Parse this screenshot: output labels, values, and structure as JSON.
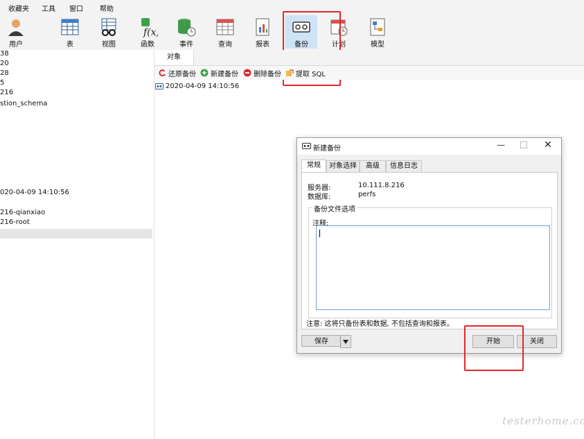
{
  "menu": {
    "items": [
      "收藏夹",
      "工具",
      "窗口",
      "帮助"
    ]
  },
  "toolbar": {
    "user": "用户",
    "table": "表",
    "view": "视图",
    "function": "函数",
    "event": "事件",
    "query": "查询",
    "report": "报表",
    "backup": "备份",
    "schedule": "计划",
    "model": "模型"
  },
  "tree": {
    "rows": [
      "38",
      "20",
      "28",
      "5",
      "216",
      "stion_schema",
      "020-04-09 14:10:56",
      "216-qianxiao",
      "216-root"
    ]
  },
  "object_tab": "对象",
  "subtoolbar": {
    "restore": "还原备份",
    "new": "新建备份",
    "delete": "删除备份",
    "extract": "提取 SQL"
  },
  "backup_list": [
    "2020-04-09 14:10:56"
  ],
  "dialog": {
    "title": "新建备份",
    "tabs": [
      "常规",
      "对象选择",
      "高级",
      "信息日志"
    ],
    "server_label": "服务器:",
    "server_value": "10.111.8.216",
    "db_label": "数据库:",
    "db_value": "perfs",
    "group_title": "备份文件选项",
    "comment_label": "注释:",
    "note": "注意: 这将只备份表和数据, 不包括查询和报表。",
    "save": "保存",
    "start": "开始",
    "close": "关闭"
  },
  "watermark": "testerhome.com",
  "colors": {
    "highlight": "#e3262b",
    "selected_tool": "#cfe3f7",
    "text_focus": "#6f9fd0"
  }
}
